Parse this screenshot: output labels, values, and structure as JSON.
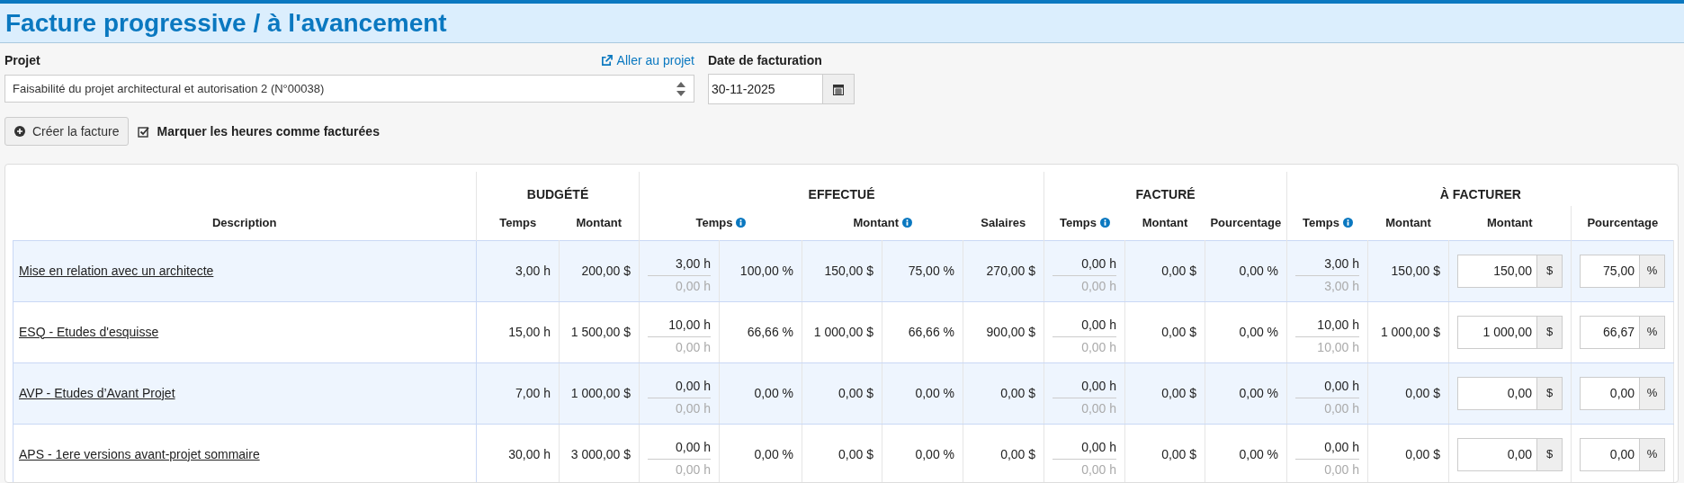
{
  "title": "Facture progressive / à l'avancement",
  "form": {
    "project_label": "Projet",
    "project_link": "Aller au projet",
    "project_value": "Faisabilité du projet architectural et autorisation 2 (N°00038)",
    "date_label": "Date de facturation",
    "date_value": "30-11-2025",
    "create_button": "Créer la facture",
    "mark_hours": {
      "label": "Marquer les heures comme facturées",
      "checked": true
    }
  },
  "table": {
    "groups": [
      {
        "label": "BUDGÉTÉ"
      },
      {
        "label": "EFFECTUÉ"
      },
      {
        "label": "FACTURÉ"
      },
      {
        "label": "À FACTURER"
      }
    ],
    "columns": [
      {
        "label": "Description",
        "info": false
      },
      {
        "label": "Temps",
        "info": false
      },
      {
        "label": "Montant",
        "info": false
      },
      {
        "label": "Temps",
        "info": true
      },
      {
        "label": "Montant",
        "info": true
      },
      {
        "label": "Salaires",
        "info": false
      },
      {
        "label": "Temps",
        "info": true
      },
      {
        "label": "Montant",
        "info": false
      },
      {
        "label": "Pourcentage",
        "info": false
      },
      {
        "label": "Temps",
        "info": true
      },
      {
        "label": "Montant",
        "info": false
      },
      {
        "label": "Montant",
        "info": false
      },
      {
        "label": "Pourcentage",
        "info": false
      }
    ],
    "rows": [
      {
        "description": "Mise en relation avec un architecte",
        "budget_time": "3,00 h",
        "budget_amount": "200,00 $",
        "done_time": "3,00 h",
        "done_time_sub": "0,00 h",
        "done_time_pct": "100,00 %",
        "done_amount": "150,00 $",
        "done_amount_pct": "75,00 %",
        "salaries": "270,00 $",
        "billed_time": "0,00 h",
        "billed_time_sub": "0,00 h",
        "billed_amount": "0,00 $",
        "billed_pct": "0,00 %",
        "tobill_time": "3,00 h",
        "tobill_time_sub": "3,00 h",
        "tobill_amount": "150,00 $",
        "amount_input": {
          "value": "150,00",
          "unit": "$"
        },
        "pct_input": {
          "value": "75,00",
          "unit": "%"
        }
      },
      {
        "description": "ESQ - Etudes d'esquisse",
        "budget_time": "15,00 h",
        "budget_amount": "1 500,00 $",
        "done_time": "10,00 h",
        "done_time_sub": "0,00 h",
        "done_time_pct": "66,66 %",
        "done_amount": "1 000,00 $",
        "done_amount_pct": "66,66 %",
        "salaries": "900,00 $",
        "billed_time": "0,00 h",
        "billed_time_sub": "0,00 h",
        "billed_amount": "0,00 $",
        "billed_pct": "0,00 %",
        "tobill_time": "10,00 h",
        "tobill_time_sub": "10,00 h",
        "tobill_amount": "1 000,00 $",
        "amount_input": {
          "value": "1 000,00",
          "unit": "$"
        },
        "pct_input": {
          "value": "66,67",
          "unit": "%"
        }
      },
      {
        "description": "AVP - Etudes d’Avant Projet",
        "budget_time": "7,00 h",
        "budget_amount": "1 000,00 $",
        "done_time": "0,00 h",
        "done_time_sub": "0,00 h",
        "done_time_pct": "0,00 %",
        "done_amount": "0,00 $",
        "done_amount_pct": "0,00 %",
        "salaries": "0,00 $",
        "billed_time": "0,00 h",
        "billed_time_sub": "0,00 h",
        "billed_amount": "0,00 $",
        "billed_pct": "0,00 %",
        "tobill_time": "0,00 h",
        "tobill_time_sub": "0,00 h",
        "tobill_amount": "0,00 $",
        "amount_input": {
          "value": "0,00",
          "unit": "$"
        },
        "pct_input": {
          "value": "0,00",
          "unit": "%"
        }
      },
      {
        "description": "APS - 1ere versions avant-projet sommaire",
        "budget_time": "30,00 h",
        "budget_amount": "3 000,00 $",
        "done_time": "0,00 h",
        "done_time_sub": "0,00 h",
        "done_time_pct": "0,00 %",
        "done_amount": "0,00 $",
        "done_amount_pct": "0,00 %",
        "salaries": "0,00 $",
        "billed_time": "0,00 h",
        "billed_time_sub": "0,00 h",
        "billed_amount": "0,00 $",
        "billed_pct": "0,00 %",
        "tobill_time": "0,00 h",
        "tobill_time_sub": "0,00 h",
        "tobill_amount": "0,00 $",
        "amount_input": {
          "value": "0,00",
          "unit": "$"
        },
        "pct_input": {
          "value": "0,00",
          "unit": "%"
        }
      }
    ]
  }
}
